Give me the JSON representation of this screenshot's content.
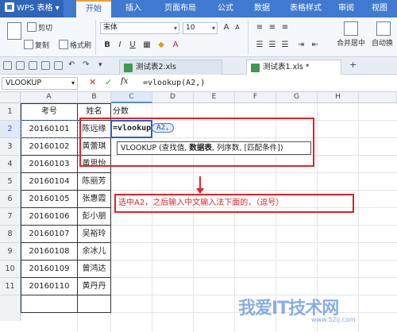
{
  "app": {
    "name": "WPS 表格"
  },
  "menu": [
    "开始",
    "插入",
    "页面布局",
    "公式",
    "数据",
    "表格样式",
    "审阅",
    "视图"
  ],
  "ribbon": {
    "cut": "剪切",
    "copy": "复制",
    "format_painter": "格式刷",
    "font_name": "宋体",
    "font_size": "10",
    "merge_center": "合并居中",
    "auto_wrap": "自动换"
  },
  "doc_tabs": [
    {
      "label": "测试表2.xls",
      "active": false
    },
    {
      "label": "测试表1.xls *",
      "active": true
    }
  ],
  "formula_bar": {
    "name_box": "VLOOKUP",
    "cancel": "✕",
    "confirm": "✓",
    "fx": "fx",
    "content": "=vlookup(A2,)"
  },
  "columns": [
    "A",
    "B",
    "C",
    "D",
    "E",
    "F",
    "G",
    "H"
  ],
  "rows": [
    "1",
    "2",
    "3",
    "4",
    "5",
    "6",
    "7",
    "8",
    "9",
    "10",
    "11"
  ],
  "table": {
    "headers": [
      "考号",
      "姓名",
      "分数"
    ],
    "data": [
      [
        "20160101",
        "陈远缘"
      ],
      [
        "20160102",
        "黄蕾琪"
      ],
      [
        "20160103",
        "黄思怡"
      ],
      [
        "20160104",
        "陈丽芳"
      ],
      [
        "20160105",
        "张惠霞"
      ],
      [
        "20160106",
        "彭小朋"
      ],
      [
        "20160107",
        "吴裕玲"
      ],
      [
        "20160108",
        "余冰儿"
      ],
      [
        "20160109",
        "曾鸿达"
      ],
      [
        "20160110",
        "黄丹丹"
      ]
    ]
  },
  "editing_cell": {
    "ref": "C2",
    "text": "=vlookup",
    "arg": "A2,"
  },
  "tooltip": {
    "prefix": "VLOOKUP (查找值, ",
    "bold": "数据表",
    "suffix": ", 列序数, [匹配条件])"
  },
  "annotation": "选中A2，之后输入中文输入法下面的，（逗号）",
  "watermark": {
    "main": "我爱IT技术网",
    "sub": "www.52ij.com"
  },
  "colors": {
    "accent": "#3f7ad0",
    "annotation_red": "#e0242a"
  }
}
